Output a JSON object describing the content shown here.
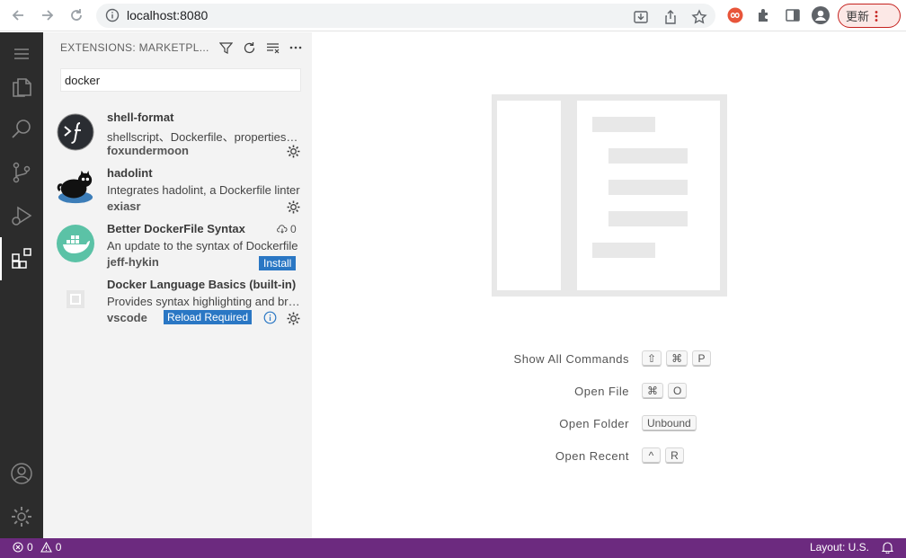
{
  "browser": {
    "url": "localhost:8080",
    "update_label": "更新"
  },
  "sidebar": {
    "title": "EXTENSIONS: MARKETPL...",
    "search_value": "docker",
    "extensions": [
      {
        "name": "shell-format",
        "description": "shellscript、Dockerfile、properties、gitignore",
        "publisher": "foxundermoon"
      },
      {
        "name": "hadolint",
        "description": "Integrates hadolint, a Dockerfile linter",
        "publisher": "exiasr"
      },
      {
        "name": "Better DockerFile Syntax",
        "description": "An update to the syntax of Dockerfile",
        "publisher": "jeff-hykin",
        "download_count": "0",
        "action_label": "Install"
      },
      {
        "name": "Docker Language Basics (built-in)",
        "description": "Provides syntax highlighting and bracket matching",
        "publisher": "vscode",
        "action_label": "Reload Required"
      }
    ]
  },
  "editor": {
    "commands": [
      {
        "label": "Show All Commands",
        "keys": [
          "⇧",
          "⌘",
          "P"
        ]
      },
      {
        "label": "Open File",
        "keys": [
          "⌘",
          "O"
        ]
      },
      {
        "label": "Open Folder",
        "keys": [
          "Unbound"
        ]
      },
      {
        "label": "Open Recent",
        "keys": [
          "^",
          "R"
        ]
      }
    ]
  },
  "status": {
    "errors": "0",
    "warnings": "0",
    "layout": "Layout: U.S."
  },
  "colors": {
    "activity_bar": "#2c2c2c",
    "status_bar": "#6c2a7f",
    "button_blue": "#2a77c4"
  }
}
